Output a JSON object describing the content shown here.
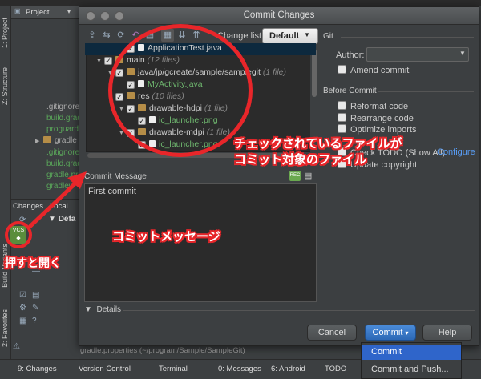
{
  "ide": {
    "project_tab": "Project",
    "vtabs": [
      "1: Project",
      "Z: Structure",
      "Build Variants",
      "2: Favorites"
    ],
    "project_tree": [
      {
        "label": ".gitignore",
        "color": "normal"
      },
      {
        "label": "build.gradle",
        "color": "green"
      },
      {
        "label": "proguard-rules.pro",
        "color": "green"
      },
      {
        "label": "gradle",
        "color": "normal"
      },
      {
        "label": ".gitignore",
        "color": "green"
      },
      {
        "label": "build.gradle",
        "color": "green"
      },
      {
        "label": "gradle.properties",
        "color": "green"
      },
      {
        "label": "gradlew",
        "color": "green"
      }
    ],
    "changes_tabs": [
      "Changes",
      "Local"
    ],
    "changes_default": "Defa",
    "bottom_tabs": [
      "9: Changes",
      "Version Control",
      "Terminal",
      "0: Messages",
      "6: Android",
      "TODO"
    ],
    "gradle_path": "gradle.properties (~/program/Sample/SampleGit)"
  },
  "dialog": {
    "title": "Commit Changes",
    "change_list_label": "Change list:",
    "change_list_value": "Default",
    "files": [
      {
        "indent": 3,
        "tri": "",
        "icon": "file",
        "label": "ApplicationTest.java",
        "note": "",
        "green": false,
        "selected": true
      },
      {
        "indent": 1,
        "tri": "▼",
        "icon": "folder",
        "label": "main",
        "note": "(12 files)",
        "green": false,
        "selected": false
      },
      {
        "indent": 2,
        "tri": "▼",
        "icon": "folder",
        "label": "java/jp/gcreate/sample/samplegit",
        "note": "(1 file)",
        "green": false,
        "selected": false
      },
      {
        "indent": 3,
        "tri": "",
        "icon": "file",
        "label": "MyActivity.java",
        "note": "",
        "green": true,
        "selected": false
      },
      {
        "indent": 2,
        "tri": "▼",
        "icon": "folder",
        "label": "res",
        "note": "(10 files)",
        "green": false,
        "selected": false
      },
      {
        "indent": 3,
        "tri": "▼",
        "icon": "folder",
        "label": "drawable-hdpi",
        "note": "(1 file)",
        "green": false,
        "selected": false
      },
      {
        "indent": 4,
        "tri": "",
        "icon": "file",
        "label": "ic_launcher.png",
        "note": "",
        "green": true,
        "selected": false
      },
      {
        "indent": 3,
        "tri": "▼",
        "icon": "folder",
        "label": "drawable-mdpi",
        "note": "(1 file)",
        "green": false,
        "selected": false
      },
      {
        "indent": 4,
        "tri": "",
        "icon": "file",
        "label": "ic_launcher.png",
        "note": "",
        "green": true,
        "selected": false
      }
    ],
    "git_section": "Git",
    "author_label": "Author:",
    "amend_commit": "Amend commit",
    "before_commit": "Before Commit",
    "options": [
      "Reformat code",
      "Rearrange code",
      "Optimize imports"
    ],
    "check_todo": "Check TODO (Show All)",
    "configure": "Configure",
    "copyright": "Update copyright",
    "commit_message_label": "Commit Message",
    "commit_message_text": "First commit",
    "details_label": "Details",
    "buttons": {
      "cancel": "Cancel",
      "commit": "Commit",
      "help": "Help"
    },
    "commit_menu": [
      "Commit",
      "Commit and Push..."
    ]
  },
  "annotations": {
    "files_note_line1": "チェックされているファイルが",
    "files_note_line2": "コミット対象のファイル",
    "message_note": "コミットメッセージ",
    "open_note": "押すと開く",
    "vcs_icon_text": "VCS",
    "accent_color": "#e8262a"
  }
}
